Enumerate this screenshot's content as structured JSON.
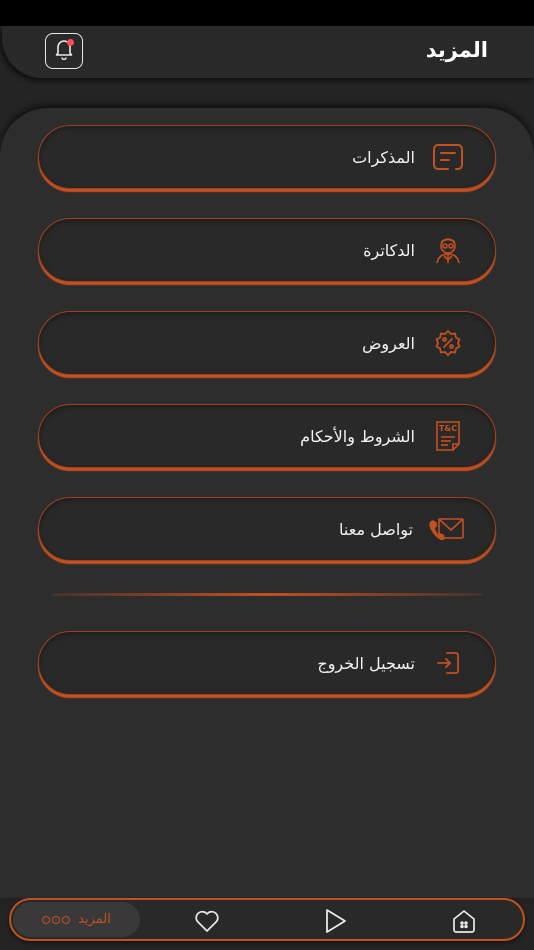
{
  "header": {
    "title": "المزيد",
    "notification_has_unread": true
  },
  "menu": [
    {
      "label": "المذكرات",
      "icon": "notes-icon"
    },
    {
      "label": "الدكاترة",
      "icon": "doctor-icon"
    },
    {
      "label": "العروض",
      "icon": "discount-badge-icon"
    },
    {
      "label": "الشروط والأحكام",
      "icon": "terms-conditions-icon",
      "icon_text": "T&C"
    },
    {
      "label": "تواصل معنا",
      "icon": "contact-mail-phone-icon"
    }
  ],
  "logout": {
    "label": "تسجيل الخروج",
    "icon": "logout-icon"
  },
  "bottom_nav": {
    "active": {
      "label": "المزيد",
      "icon": "more-dots-icon"
    },
    "items": [
      "heart-icon",
      "play-icon",
      "home-icon"
    ]
  },
  "colors": {
    "accent": "#c4501f",
    "background": "#252424",
    "panel": "#2e2d2d",
    "badge": "#ff4d56"
  }
}
